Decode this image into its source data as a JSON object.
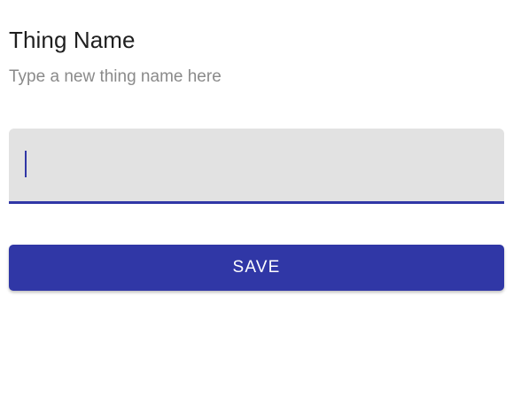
{
  "form": {
    "title": "Thing Name",
    "subtitle": "Type a new thing name here",
    "input_value": "",
    "save_label": "SAVE"
  },
  "colors": {
    "accent": "#3037a6",
    "field_background": "#e2e2e2",
    "title_text": "#1f1f1f",
    "subtitle_text": "#8a8a8a"
  }
}
